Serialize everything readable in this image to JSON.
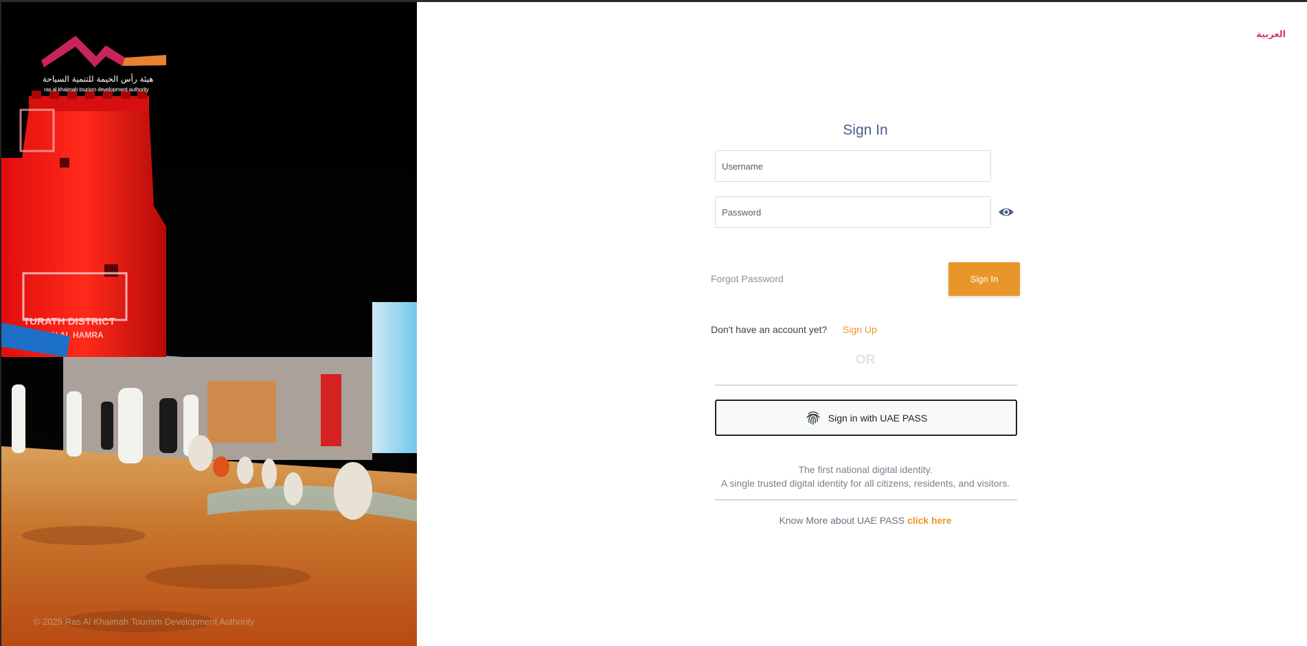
{
  "language_toggle": "العربية",
  "brand": {
    "name_ar": "هيئة رأس الخيمة للتنمية السياحة",
    "name_en": "ras al khaimah tourism development authority",
    "colors": {
      "logo_red": "#c8245a",
      "logo_orange": "#e9822e"
    }
  },
  "background": {
    "sign_text_1": "TURATH DISTRICT",
    "sign_text_2": "JAZIRAH AL HAMRA"
  },
  "footer": {
    "copyright": "© 2025 Ras Al Khaimah Tourism Development Authority"
  },
  "form": {
    "title": "Sign In",
    "username_placeholder": "Username",
    "password_placeholder": "Password",
    "forgot_password": "Forgot Password",
    "signin_button": "Sign In",
    "no_account_text": "Don't have an account yet?",
    "signup_link": "Sign Up",
    "or_text": "OR",
    "uaepass_button": "Sign in with UAE PASS",
    "uaepass_desc_1": "The first national digital identity.",
    "uaepass_desc_2": "A single trusted digital identity for all citizens, residents, and visitors.",
    "know_more_prefix": "Know More about UAE PASS",
    "know_more_link": "click here"
  },
  "icons": {
    "password_toggle": "eye-icon",
    "uaepass": "fingerprint-icon"
  },
  "colors": {
    "accent": "#e8962a",
    "title": "#4a5a8a",
    "language_link": "#d63a63"
  }
}
